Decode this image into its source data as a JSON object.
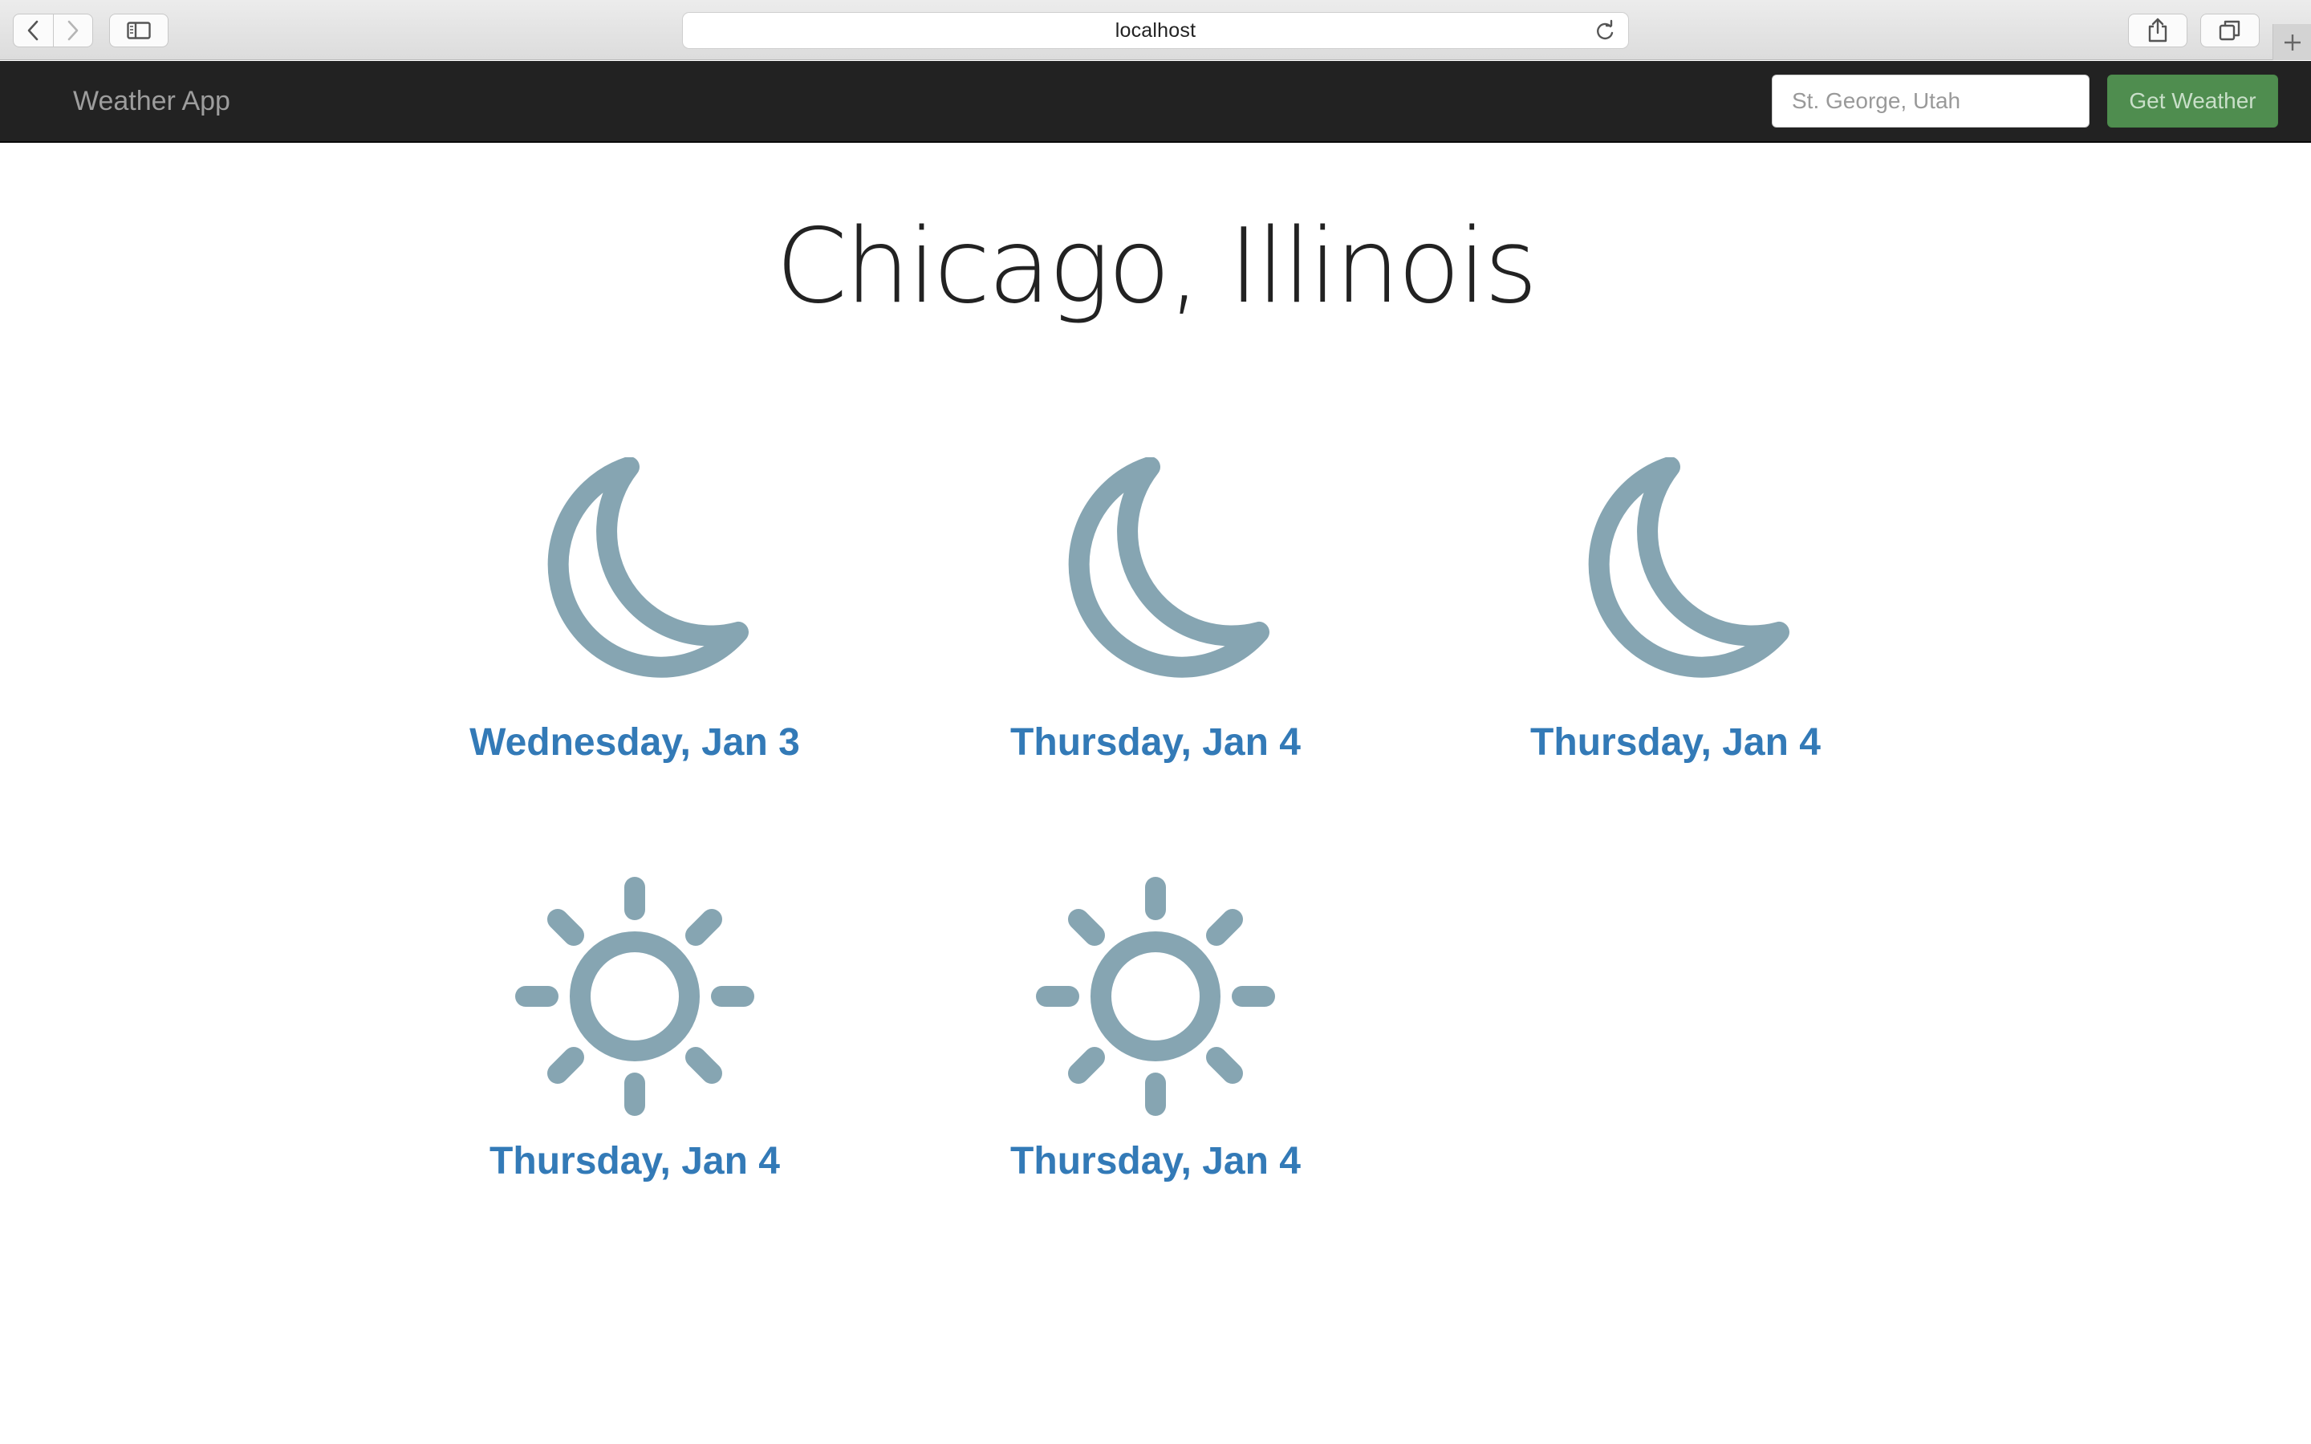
{
  "browser": {
    "address": "localhost"
  },
  "navbar": {
    "brand": "Weather App",
    "search_placeholder": "St. George, Utah",
    "button_label": "Get Weather"
  },
  "main": {
    "city": "Chicago, Illinois",
    "forecasts": [
      {
        "date": "Wednesday, Jan 3",
        "icon": "moon-icon"
      },
      {
        "date": "Thursday, Jan 4",
        "icon": "moon-icon"
      },
      {
        "date": "Thursday, Jan 4",
        "icon": "moon-icon"
      },
      {
        "date": "Thursday, Jan 4",
        "icon": "sun-icon"
      },
      {
        "date": "Thursday, Jan 4",
        "icon": "sun-icon"
      }
    ]
  },
  "colors": {
    "navbar_bg": "#222222",
    "brand_text": "#9d9d9d",
    "button_bg": "#4f8d4f",
    "date_link": "#337ab7",
    "icon_fill": "#86a5b2"
  }
}
